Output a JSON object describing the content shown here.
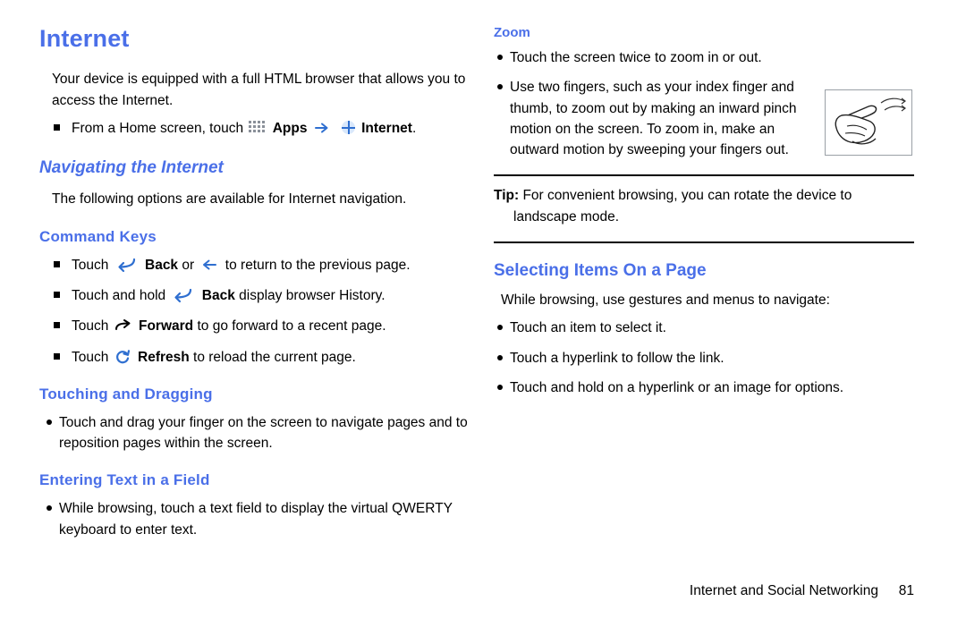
{
  "page": {
    "title": "Internet",
    "footer_text": "Internet and Social Networking",
    "footer_page_number": "81",
    "accent_color": "#4a6fe8"
  },
  "left_column": {
    "intro": "Your device is equipped with a full HTML browser that allows you to access the Internet.",
    "home_step": {
      "prefix": "From a Home screen, touch",
      "apps_label": "Apps",
      "internet_label": "Internet",
      "suffix": "."
    },
    "navigating_heading": "Navigating the Internet",
    "navigating_text": "The following options are available for Internet navigation.",
    "command_keys_heading": "Command Keys",
    "command_keys": [
      {
        "prefix": "Touch",
        "icon": "back-arrow-icon",
        "bold": "Back",
        "mid": "or",
        "icon2": "left-arrow-icon",
        "suffix": "to return to the previous page."
      },
      {
        "prefix": "Touch and hold",
        "icon": "back-arrow-icon",
        "bold": "Back",
        "suffix": "display browser History."
      },
      {
        "prefix": "Touch",
        "icon": "forward-arrow-icon",
        "bold": "Forward",
        "suffix": "to go forward to a recent page."
      },
      {
        "prefix": "Touch",
        "icon": "refresh-icon",
        "bold": "Refresh",
        "suffix": "to reload the current page."
      }
    ],
    "touching_heading": "Touching and Dragging",
    "touching_bullet": "Touch and drag your finger on the screen to navigate pages and to reposition pages within the screen.",
    "entering_heading": "Entering Text in a Field",
    "entering_bullet": "While browsing, touch a text field to display the virtual QWERTY keyboard to enter text."
  },
  "right_column": {
    "zoom_heading": "Zoom",
    "zoom_bullets": [
      "Touch the screen twice to zoom in or out.",
      "Use two fingers, such as your index finger and thumb, to zoom out by making an inward pinch motion on the screen. To zoom in, make an outward motion by sweeping your fingers out."
    ],
    "tip_label": "Tip:",
    "tip_text_line1": "For convenient browsing, you can rotate the device to",
    "tip_text_line2": "landscape mode.",
    "selecting_heading": "Selecting Items On a Page",
    "selecting_text": "While browsing, use gestures and menus to navigate:",
    "selecting_bullets": [
      "Touch an item to select it.",
      "Touch a hyperlink to follow the link.",
      "Touch and hold on a hyperlink or an image for options."
    ],
    "illustration": "pinch-zoom-hand-illustration"
  }
}
